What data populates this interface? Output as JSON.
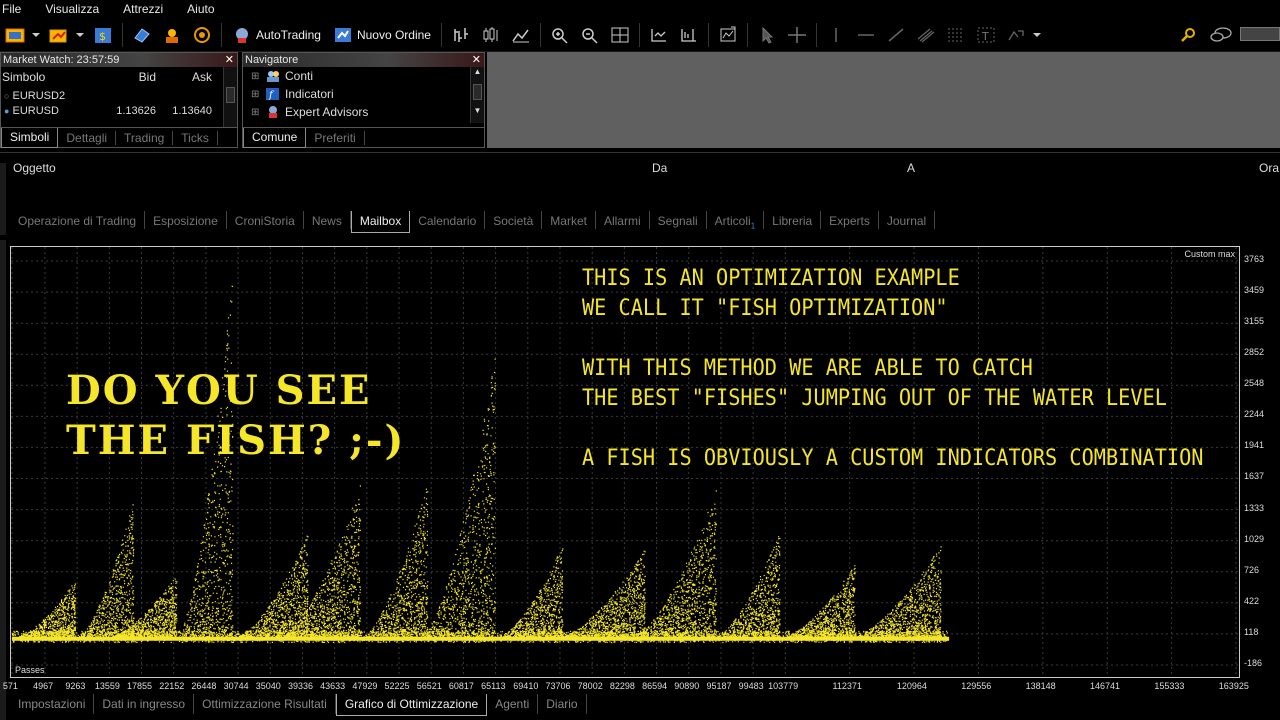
{
  "menu": [
    "File",
    "Visualizza",
    "Attrezzi",
    "Aiuto"
  ],
  "toolbar": {
    "autotrading_label": "AutoTrading",
    "new_order_label": "Nuovo Ordine"
  },
  "market_watch": {
    "title": "Market Watch: 23:57:59",
    "col_symbol": "Simbolo",
    "col_bid": "Bid",
    "col_ask": "Ask",
    "rows": [
      {
        "symbol": "EURUSD2",
        "bid": "",
        "ask": ""
      },
      {
        "symbol": "EURUSD",
        "bid": "1.13626",
        "ask": "1.13640"
      }
    ],
    "tabs": [
      "Simboli",
      "Dettagli",
      "Trading",
      "Ticks"
    ],
    "active_tab": "Simboli"
  },
  "navigator": {
    "title": "Navigatore",
    "items": [
      "Conti",
      "Indicatori",
      "Expert Advisors"
    ],
    "tabs": [
      "Comune",
      "Preferiti"
    ],
    "active_tab": "Comune"
  },
  "toolbox": {
    "columns": {
      "object": "Oggetto",
      "from": "Da",
      "to": "A",
      "time": "Ora"
    },
    "tabs": [
      "Operazione di Trading",
      "Esposizione",
      "CroniStoria",
      "News",
      "Mailbox",
      "Calendario",
      "Società",
      "Market",
      "Allarmi",
      "Segnali",
      "Articoli",
      "Libreria",
      "Experts",
      "Journal"
    ],
    "active_tab": "Mailbox",
    "articoli_badge": "1"
  },
  "chart": {
    "custom_max_label": "Custom max",
    "passes_label": "Passes",
    "y_ticks": [
      "3763",
      "3459",
      "3155",
      "2852",
      "2548",
      "2244",
      "1941",
      "1637",
      "1333",
      "1029",
      "726",
      "422",
      "118",
      "-186"
    ],
    "x_ticks": [
      "571",
      "4967",
      "9263",
      "13559",
      "17855",
      "22152",
      "26448",
      "30744",
      "35040",
      "39336",
      "43633",
      "47929",
      "52225",
      "56521",
      "60817",
      "65113",
      "69410",
      "73706",
      "78002",
      "82298",
      "86594",
      "90890",
      "95187",
      "99483",
      "103779",
      "112371",
      "120964",
      "129556",
      "138148",
      "146741",
      "155333",
      "163925"
    ],
    "overlay_left": [
      "DO YOU SEE",
      "THE FISH? ;-)"
    ],
    "overlay_right": [
      "THIS IS AN OPTIMIZATION EXAMPLE",
      "WE CALL IT \"FISH OPTIMIZATION\"",
      "",
      "WITH THIS METHOD WE ARE ABLE TO CATCH",
      "THE BEST \"FISHES\" JUMPING OUT OF THE WATER LEVEL",
      "",
      "A FISH IS OBVIOUSLY A CUSTOM INDICATORS COMBINATION"
    ],
    "point_color": "#f5e62a",
    "bg_color": "#000000"
  },
  "chart_data": {
    "type": "scatter",
    "title": "",
    "xlabel": "Passes",
    "ylabel": "Custom max",
    "xlim": [
      571,
      163925
    ],
    "ylim": [
      -186,
      3763
    ],
    "fish": [
      {
        "x_start": 571,
        "x_end": 9000,
        "peak": 650
      },
      {
        "x_start": 9000,
        "x_end": 16800,
        "peak": 1450
      },
      {
        "x_start": 13000,
        "x_end": 22500,
        "peak": 700
      },
      {
        "x_start": 22500,
        "x_end": 30000,
        "peak": 3700
      },
      {
        "x_start": 30000,
        "x_end": 40000,
        "peak": 1100
      },
      {
        "x_start": 36000,
        "x_end": 47000,
        "peak": 1600
      },
      {
        "x_start": 47000,
        "x_end": 56000,
        "peak": 1620
      },
      {
        "x_start": 55000,
        "x_end": 65000,
        "peak": 2850
      },
      {
        "x_start": 65000,
        "x_end": 74000,
        "peak": 1000
      },
      {
        "x_start": 73000,
        "x_end": 85000,
        "peak": 950
      },
      {
        "x_start": 83000,
        "x_end": 94500,
        "peak": 1550
      },
      {
        "x_start": 94000,
        "x_end": 103000,
        "peak": 1130
      },
      {
        "x_start": 103000,
        "x_end": 113000,
        "peak": 800
      },
      {
        "x_start": 112000,
        "x_end": 124500,
        "peak": 1000
      }
    ]
  },
  "bottom_tabs": [
    "Impostazioni",
    "Dati in ingresso",
    "Ottimizzazione Risultati",
    "Grafico di Ottimizzazione",
    "Agenti",
    "Diario"
  ],
  "bottom_active_tab": "Grafico di Ottimizzazione"
}
